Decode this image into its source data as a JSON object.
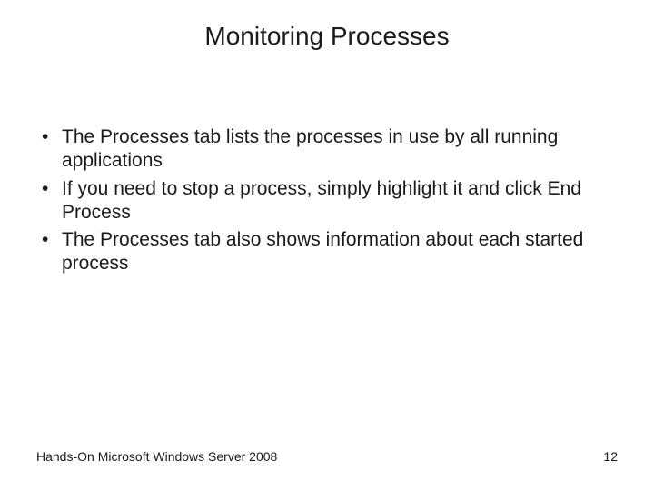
{
  "title": "Monitoring Processes",
  "bullets": [
    "The Processes tab lists the processes in use by all running applications",
    "If you need to stop a process, simply highlight it and click End Process",
    "The Processes tab also shows information about each started process"
  ],
  "footer": {
    "left": "Hands-On Microsoft Windows Server 2008",
    "right": "12"
  }
}
